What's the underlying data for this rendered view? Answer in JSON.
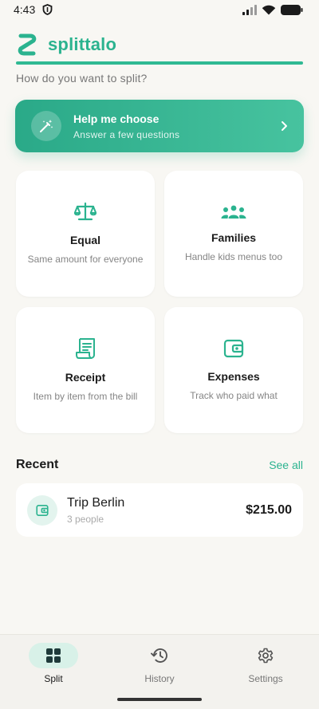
{
  "status_bar": {
    "time": "4:43"
  },
  "header": {
    "app_name": "splittalo",
    "subtitle": "How do you want to split?"
  },
  "help_card": {
    "title": "Help me choose",
    "subtitle": "Answer a few questions"
  },
  "tiles": [
    {
      "title": "Equal",
      "desc": "Same amount for everyone",
      "icon": "scale-icon"
    },
    {
      "title": "Families",
      "desc": "Handle kids menus too",
      "icon": "family-icon"
    },
    {
      "title": "Receipt",
      "desc": "Item by item from the bill",
      "icon": "receipt-icon"
    },
    {
      "title": "Expenses",
      "desc": "Track who paid what",
      "icon": "wallet-icon"
    }
  ],
  "recent": {
    "title": "Recent",
    "see_all": "See all",
    "items": [
      {
        "name": "Trip Berlin",
        "people": "3 people",
        "amount": "$215.00"
      }
    ]
  },
  "bottom_nav": [
    {
      "label": "Split",
      "icon": "grid-icon",
      "active": true
    },
    {
      "label": "History",
      "icon": "history-icon",
      "active": false
    },
    {
      "label": "Settings",
      "icon": "gear-icon",
      "active": false
    }
  ],
  "colors": {
    "accent": "#2bb38f",
    "background": "#f8f7f3",
    "card": "#ffffff"
  }
}
